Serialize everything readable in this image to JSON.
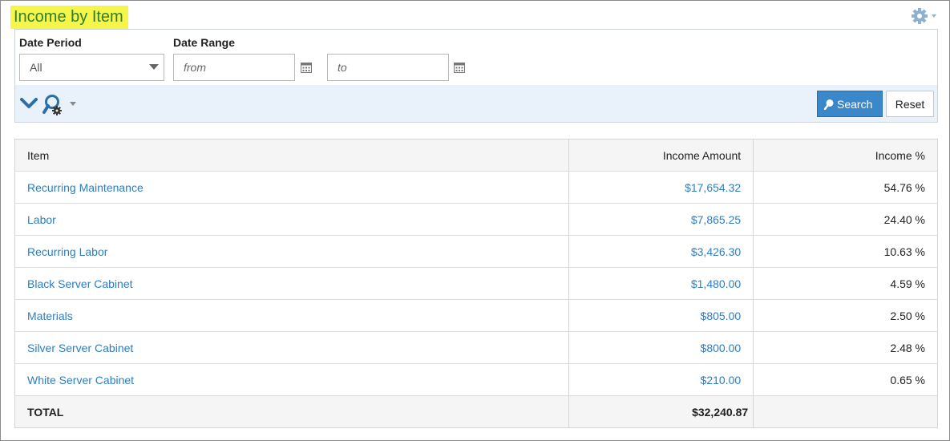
{
  "page": {
    "title": "Income by Item"
  },
  "header": {
    "settings_icon": "gear-icon"
  },
  "filters": {
    "date_period_label": "Date Period",
    "date_period_value": "All",
    "date_range_label": "Date Range",
    "from_placeholder": "from",
    "to_placeholder": "to",
    "calendar_icon": "calendar-icon"
  },
  "toolbar": {
    "collapse_icon": "chevron-down-icon",
    "advanced_search_icon": "search-gear-icon",
    "search_label": "Search",
    "reset_label": "Reset",
    "accent": "#3a87c9"
  },
  "table": {
    "headers": [
      "Item",
      "Income Amount",
      "Income %"
    ],
    "rows": [
      {
        "item": "Recurring Maintenance",
        "amount": "$17,654.32",
        "percent": "54.76 %"
      },
      {
        "item": "Labor",
        "amount": "$7,865.25",
        "percent": "24.40 %"
      },
      {
        "item": "Recurring Labor",
        "amount": "$3,426.30",
        "percent": "10.63 %"
      },
      {
        "item": "Black Server Cabinet",
        "amount": "$1,480.00",
        "percent": "4.59 %"
      },
      {
        "item": "Materials",
        "amount": "$805.00",
        "percent": "2.50 %"
      },
      {
        "item": "Silver Server Cabinet",
        "amount": "$800.00",
        "percent": "2.48 %"
      },
      {
        "item": "White Server Cabinet",
        "amount": "$210.00",
        "percent": "0.65 %"
      }
    ],
    "total": {
      "label": "TOTAL",
      "amount": "$32,240.87"
    }
  },
  "colors": {
    "title_highlight": "#f5f54a",
    "title_text": "#2e7d32",
    "link": "#2e7ebf"
  }
}
